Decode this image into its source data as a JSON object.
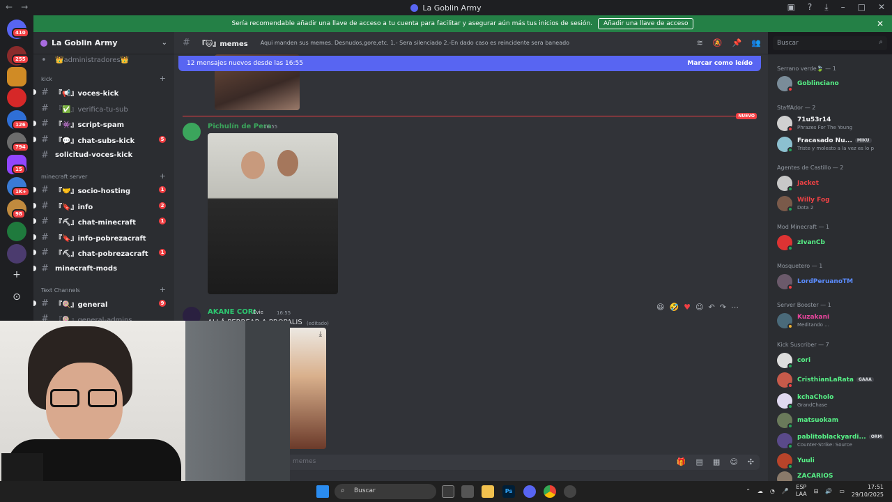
{
  "window": {
    "title": "La Goblin Army"
  },
  "banner": {
    "text": "Sería recomendable añadir una llave de acceso a tu cuenta para facilitar y asegurar aún más tus inicios de sesión.",
    "cta": "Añadir una llave de acceso"
  },
  "servers": {
    "badges": [
      "410",
      "255",
      "126",
      "794",
      "15",
      "1K+",
      "98"
    ]
  },
  "sidebar": {
    "guild_name": "La Goblin Army",
    "top_item": "👑administradores👑",
    "categories": {
      "kick": "kick",
      "minecraft": "minecraft server",
      "text": "Text Channels"
    },
    "channels": [
      {
        "label": "『📢』voces-kick"
      },
      {
        "label": "『✅』verifica-tu-sub"
      },
      {
        "label": "『👾』script-spam"
      },
      {
        "label": "『💬』chat-subs-kick",
        "count": "5"
      },
      {
        "label": "solicitud-voces-kick"
      },
      {
        "label": "『🤝』socio-hosting",
        "count": "1"
      },
      {
        "label": "『🔖』info",
        "count": "2"
      },
      {
        "label": "『⛏』chat-minecraft",
        "count": "1"
      },
      {
        "label": "『🔖』info-pobrezacraft"
      },
      {
        "label": "『⛏』chat-pobrezacraft",
        "count": "1"
      },
      {
        "label": "minecraft-mods"
      },
      {
        "label": "『🍭』general",
        "count": "9"
      },
      {
        "label": "『🍭』general-admins"
      }
    ]
  },
  "header": {
    "channel": "『🐱』memes",
    "topic": "Aqui manden sus memes. Desnudos,gore,etc. 1.- Sera silenciado 2.-En dado caso es reincidente sera baneado",
    "search_placeholder": "Buscar"
  },
  "chat": {
    "new_messages": "12 mensajes nuevos desde las 16:55",
    "mark_read": "Marcar como leído",
    "new_tag": "NUEVO",
    "messages": [
      {
        "author": "Pichulín de Pera",
        "time": "16:55",
        "color": "#3ba55c"
      },
      {
        "author": "AKANE CORI",
        "time": "16:55",
        "tag": "Evie",
        "text": "ALLÁ PERREAR A PROPALIS",
        "edited": "(editado)",
        "color": "#2dc770"
      }
    ],
    "composer_placeholder": "memes"
  },
  "members": {
    "groups": [
      {
        "title": "Serrano verde🍃 — 1",
        "members": [
          {
            "name": "Goblinciano",
            "color": "#57f287"
          }
        ]
      },
      {
        "title": "StaffAdor — 2",
        "members": [
          {
            "name": "71u53r14",
            "sub": "Phrazes For The Young",
            "color": "#f2f3f5"
          },
          {
            "name": "Fracasado Nu...",
            "tag": "MIKU",
            "sub": "Triste y molesto a la vez es lo p",
            "color": "#f2f3f5"
          }
        ]
      },
      {
        "title": "Agentes de Castillo — 2",
        "members": [
          {
            "name": "Jacket",
            "color": "#ed4245"
          },
          {
            "name": "Willy Fog",
            "sub": "Dota 2",
            "color": "#ed4245"
          }
        ]
      },
      {
        "title": "Mod Minecraft — 1",
        "members": [
          {
            "name": "zIvanCb",
            "color": "#57f287"
          }
        ]
      },
      {
        "title": "Mosquetero — 1",
        "members": [
          {
            "name": "LordPeruanoTM",
            "color": "#5b8cff"
          }
        ]
      },
      {
        "title": "Server Booster — 1",
        "members": [
          {
            "name": "Kuzakani",
            "sub": "Meditando ...",
            "color": "#eb459e"
          }
        ]
      },
      {
        "title": "Kick Suscriber — 7",
        "members": [
          {
            "name": "cori",
            "color": "#57f287"
          },
          {
            "name": "CristhianLaRata",
            "tag": "GAAA",
            "color": "#57f287"
          },
          {
            "name": "kchaCholo",
            "sub": "GrandChase",
            "color": "#57f287"
          },
          {
            "name": "matsuokam",
            "color": "#57f287"
          },
          {
            "name": "pablitoblackyardi...",
            "tag": "ORM",
            "sub": "Counter-Strike: Source",
            "color": "#57f287"
          },
          {
            "name": "Yuuli",
            "color": "#57f287"
          },
          {
            "name": "ZACARIOS",
            "color": "#57f287"
          }
        ]
      }
    ]
  },
  "taskbar": {
    "search": "Buscar",
    "lang": "ESP",
    "lang2": "LAA",
    "time": "17:51",
    "date": "29/10/2025"
  }
}
